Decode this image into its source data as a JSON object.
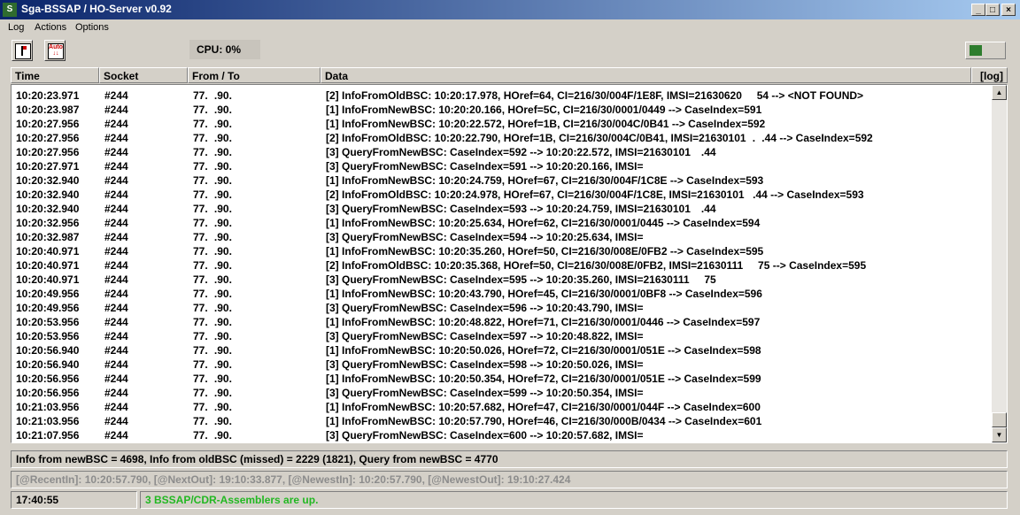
{
  "window": {
    "title": "Sga-BSSAP / HO-Server  v0.92",
    "app_icon": "S"
  },
  "menu": {
    "items": [
      "Log",
      "Actions",
      "Options"
    ]
  },
  "toolbar": {
    "button2_text": "Auto"
  },
  "cpu": {
    "label": "CPU:  0%"
  },
  "columns": {
    "time": "Time",
    "socket": "Socket",
    "from_to": "From / To",
    "data": "Data",
    "log": "[log]"
  },
  "rows": [
    {
      "time": "10:20:23.971",
      "socket": "#244",
      "from": "77.   .90.  ",
      "data": "[2] InfoFromOldBSC: 10:20:17.978, HOref=64, CI=216/30/004F/1E8F, IMSI=21630620       54  -->  <NOT FOUND>"
    },
    {
      "time": "10:20:23.987",
      "socket": "#244",
      "from": "77.   .90.  ",
      "data": "[1] InfoFromNewBSC: 10:20:20.166, HOref=5C, CI=216/30/0001/0449  -->  CaseIndex=591"
    },
    {
      "time": "10:20:27.956",
      "socket": "#244",
      "from": "77.   .90.  ",
      "data": "[1] InfoFromNewBSC: 10:20:22.572, HOref=1B, CI=216/30/004C/0B41  -->  CaseIndex=592"
    },
    {
      "time": "10:20:27.956",
      "socket": "#244",
      "from": "77.   .90.  ",
      "data": "[2] InfoFromOldBSC: 10:20:22.790, HOref=1B, CI=216/30/004C/0B41, IMSI=21630101   .   .44  -->  CaseIndex=592"
    },
    {
      "time": "10:20:27.956",
      "socket": "#244",
      "from": "77.   .90.  ",
      "data": "[3] QueryFromNewBSC: CaseIndex=592  -->  10:20:22.572, IMSI=21630101     .44"
    },
    {
      "time": "10:20:27.971",
      "socket": "#244",
      "from": "77.   .90.  ",
      "data": "[3] QueryFromNewBSC: CaseIndex=591  -->  10:20:20.166, IMSI="
    },
    {
      "time": "10:20:32.940",
      "socket": "#244",
      "from": "77.   .90.  ",
      "data": "[1] InfoFromNewBSC: 10:20:24.759, HOref=67, CI=216/30/004F/1C8E  -->  CaseIndex=593"
    },
    {
      "time": "10:20:32.940",
      "socket": "#244",
      "from": "77.   .90.  ",
      "data": "[2] InfoFromOldBSC: 10:20:24.978, HOref=67, CI=216/30/004F/1C8E, IMSI=21630101    .44  -->  CaseIndex=593"
    },
    {
      "time": "10:20:32.940",
      "socket": "#244",
      "from": "77.   .90.  ",
      "data": "[3] QueryFromNewBSC: CaseIndex=593  -->  10:20:24.759, IMSI=21630101     .44"
    },
    {
      "time": "10:20:32.956",
      "socket": "#244",
      "from": "77.   .90.  ",
      "data": "[1] InfoFromNewBSC: 10:20:25.634, HOref=62, CI=216/30/0001/0445  -->  CaseIndex=594"
    },
    {
      "time": "10:20:32.987",
      "socket": "#244",
      "from": "77.   .90.  ",
      "data": "[3] QueryFromNewBSC: CaseIndex=594  -->  10:20:25.634, IMSI="
    },
    {
      "time": "10:20:40.971",
      "socket": "#244",
      "from": "77.   .90.  ",
      "data": "[1] InfoFromNewBSC: 10:20:35.260, HOref=50, CI=216/30/008E/0FB2  -->  CaseIndex=595"
    },
    {
      "time": "10:20:40.971",
      "socket": "#244",
      "from": "77.   .90.  ",
      "data": "[2] InfoFromOldBSC: 10:20:35.368, HOref=50, CI=216/30/008E/0FB2, IMSI=21630111       75  -->  CaseIndex=595"
    },
    {
      "time": "10:20:40.971",
      "socket": "#244",
      "from": "77.   .90.  ",
      "data": "[3] QueryFromNewBSC: CaseIndex=595  -->  10:20:35.260, IMSI=21630111       75"
    },
    {
      "time": "10:20:49.956",
      "socket": "#244",
      "from": "77.   .90.  ",
      "data": "[1] InfoFromNewBSC: 10:20:43.790, HOref=45, CI=216/30/0001/0BF8  -->  CaseIndex=596"
    },
    {
      "time": "10:20:49.956",
      "socket": "#244",
      "from": "77.   .90.  ",
      "data": "[3] QueryFromNewBSC: CaseIndex=596  -->  10:20:43.790, IMSI="
    },
    {
      "time": "10:20:53.956",
      "socket": "#244",
      "from": "77.   .90.  ",
      "data": "[1] InfoFromNewBSC: 10:20:48.822, HOref=71, CI=216/30/0001/0446  -->  CaseIndex=597"
    },
    {
      "time": "10:20:53.956",
      "socket": "#244",
      "from": "77.   .90.  ",
      "data": "[3] QueryFromNewBSC: CaseIndex=597  -->  10:20:48.822, IMSI="
    },
    {
      "time": "10:20:56.940",
      "socket": "#244",
      "from": "77.   .90.  ",
      "data": "[1] InfoFromNewBSC: 10:20:50.026, HOref=72, CI=216/30/0001/051E  -->  CaseIndex=598"
    },
    {
      "time": "10:20:56.940",
      "socket": "#244",
      "from": "77.   .90.  ",
      "data": "[3] QueryFromNewBSC: CaseIndex=598  -->  10:20:50.026, IMSI="
    },
    {
      "time": "10:20:56.956",
      "socket": "#244",
      "from": "77.   .90.  ",
      "data": "[1] InfoFromNewBSC: 10:20:50.354, HOref=72, CI=216/30/0001/051E  -->  CaseIndex=599"
    },
    {
      "time": "10:20:56.956",
      "socket": "#244",
      "from": "77.   .90.  ",
      "data": "[3] QueryFromNewBSC: CaseIndex=599  -->  10:20:50.354, IMSI="
    },
    {
      "time": "10:21:03.956",
      "socket": "#244",
      "from": "77.   .90.  ",
      "data": "[1] InfoFromNewBSC: 10:20:57.682, HOref=47, CI=216/30/0001/044F  -->  CaseIndex=600"
    },
    {
      "time": "10:21:03.956",
      "socket": "#244",
      "from": "77.   .90.  ",
      "data": "[1] InfoFromNewBSC: 10:20:57.790, HOref=46, CI=216/30/000B/0434  -->  CaseIndex=601"
    },
    {
      "time": "10:21:07.956",
      "socket": "#244",
      "from": "77.   .90.  ",
      "data": "[3] QueryFromNewBSC: CaseIndex=600  -->  10:20:57.682, IMSI="
    }
  ],
  "summary": "Info from newBSC = 4698,  Info from oldBSC (missed) = 2229 (1821),  Query from newBSC = 4770",
  "recent": "[@RecentIn]: 10:20:57.790,  [@NextOut]: 19:10:33.877,  [@NewestIn]: 10:20:57.790,  [@NewestOut]: 19:10:27.424",
  "status": {
    "clock": "17:40:55",
    "message": "3 BSSAP/CDR-Assemblers are up.",
    "message_color": "#22b822"
  }
}
